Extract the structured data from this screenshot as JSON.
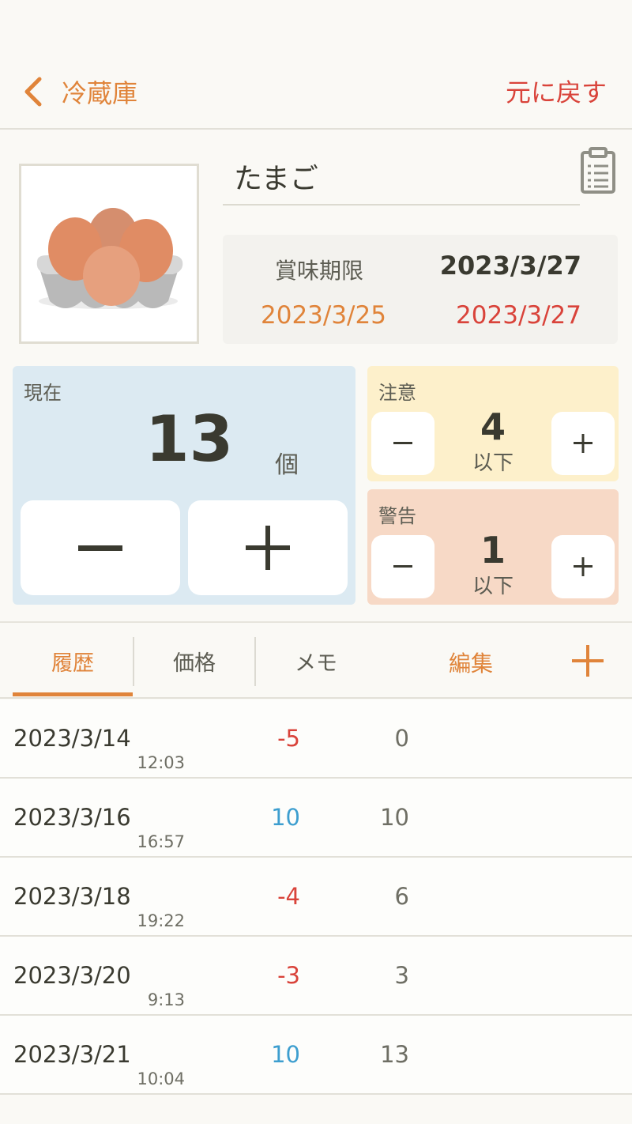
{
  "header": {
    "back_label": "冷蔵庫",
    "revert_label": "元に戻す"
  },
  "item": {
    "name": "たまご",
    "image_icon": "egg-carton-icon",
    "expiry_label": "賞味期限",
    "expiry_date": "2023/3/27",
    "notice_date": "2023/3/25",
    "warning_date": "2023/3/27"
  },
  "current": {
    "title": "現在",
    "count": "13",
    "unit": "個",
    "minus_icon": "minus-icon",
    "plus_icon": "plus-icon"
  },
  "notice": {
    "title": "注意",
    "value": "4",
    "unit": "以下"
  },
  "warning": {
    "title": "警告",
    "value": "1",
    "unit": "以下"
  },
  "tabs": {
    "history": "履歴",
    "price": "価格",
    "memo": "メモ",
    "edit": "編集"
  },
  "history": [
    {
      "date": "2023/3/14",
      "time": "12:03",
      "change": "-5",
      "total": "0"
    },
    {
      "date": "2023/3/16",
      "time": "16:57",
      "change": "10",
      "total": "10"
    },
    {
      "date": "2023/3/18",
      "time": "19:22",
      "change": "-4",
      "total": "6"
    },
    {
      "date": "2023/3/20",
      "time": "9:13",
      "change": "-3",
      "total": "3"
    },
    {
      "date": "2023/3/21",
      "time": "10:04",
      "change": "10",
      "total": "13"
    }
  ],
  "colors": {
    "accent": "#e0843a",
    "alert": "#d9433a",
    "increase": "#3d9ecf",
    "current_panel": "#dceaf2",
    "notice_panel": "#fdf0cb",
    "warning_panel": "#f7d9c6"
  }
}
